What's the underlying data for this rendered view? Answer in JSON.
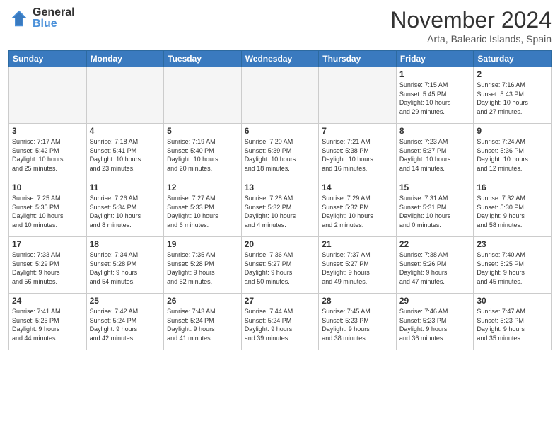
{
  "logo": {
    "general": "General",
    "blue": "Blue"
  },
  "title": "November 2024",
  "location": "Arta, Balearic Islands, Spain",
  "days_of_week": [
    "Sunday",
    "Monday",
    "Tuesday",
    "Wednesday",
    "Thursday",
    "Friday",
    "Saturday"
  ],
  "weeks": [
    [
      {
        "day": "",
        "info": "",
        "empty": true
      },
      {
        "day": "",
        "info": "",
        "empty": true
      },
      {
        "day": "",
        "info": "",
        "empty": true
      },
      {
        "day": "",
        "info": "",
        "empty": true
      },
      {
        "day": "",
        "info": "",
        "empty": true
      },
      {
        "day": "1",
        "info": "Sunrise: 7:15 AM\nSunset: 5:45 PM\nDaylight: 10 hours\nand 29 minutes."
      },
      {
        "day": "2",
        "info": "Sunrise: 7:16 AM\nSunset: 5:43 PM\nDaylight: 10 hours\nand 27 minutes."
      }
    ],
    [
      {
        "day": "3",
        "info": "Sunrise: 7:17 AM\nSunset: 5:42 PM\nDaylight: 10 hours\nand 25 minutes."
      },
      {
        "day": "4",
        "info": "Sunrise: 7:18 AM\nSunset: 5:41 PM\nDaylight: 10 hours\nand 23 minutes."
      },
      {
        "day": "5",
        "info": "Sunrise: 7:19 AM\nSunset: 5:40 PM\nDaylight: 10 hours\nand 20 minutes."
      },
      {
        "day": "6",
        "info": "Sunrise: 7:20 AM\nSunset: 5:39 PM\nDaylight: 10 hours\nand 18 minutes."
      },
      {
        "day": "7",
        "info": "Sunrise: 7:21 AM\nSunset: 5:38 PM\nDaylight: 10 hours\nand 16 minutes."
      },
      {
        "day": "8",
        "info": "Sunrise: 7:23 AM\nSunset: 5:37 PM\nDaylight: 10 hours\nand 14 minutes."
      },
      {
        "day": "9",
        "info": "Sunrise: 7:24 AM\nSunset: 5:36 PM\nDaylight: 10 hours\nand 12 minutes."
      }
    ],
    [
      {
        "day": "10",
        "info": "Sunrise: 7:25 AM\nSunset: 5:35 PM\nDaylight: 10 hours\nand 10 minutes."
      },
      {
        "day": "11",
        "info": "Sunrise: 7:26 AM\nSunset: 5:34 PM\nDaylight: 10 hours\nand 8 minutes."
      },
      {
        "day": "12",
        "info": "Sunrise: 7:27 AM\nSunset: 5:33 PM\nDaylight: 10 hours\nand 6 minutes."
      },
      {
        "day": "13",
        "info": "Sunrise: 7:28 AM\nSunset: 5:32 PM\nDaylight: 10 hours\nand 4 minutes."
      },
      {
        "day": "14",
        "info": "Sunrise: 7:29 AM\nSunset: 5:32 PM\nDaylight: 10 hours\nand 2 minutes."
      },
      {
        "day": "15",
        "info": "Sunrise: 7:31 AM\nSunset: 5:31 PM\nDaylight: 10 hours\nand 0 minutes."
      },
      {
        "day": "16",
        "info": "Sunrise: 7:32 AM\nSunset: 5:30 PM\nDaylight: 9 hours\nand 58 minutes."
      }
    ],
    [
      {
        "day": "17",
        "info": "Sunrise: 7:33 AM\nSunset: 5:29 PM\nDaylight: 9 hours\nand 56 minutes."
      },
      {
        "day": "18",
        "info": "Sunrise: 7:34 AM\nSunset: 5:28 PM\nDaylight: 9 hours\nand 54 minutes."
      },
      {
        "day": "19",
        "info": "Sunrise: 7:35 AM\nSunset: 5:28 PM\nDaylight: 9 hours\nand 52 minutes."
      },
      {
        "day": "20",
        "info": "Sunrise: 7:36 AM\nSunset: 5:27 PM\nDaylight: 9 hours\nand 50 minutes."
      },
      {
        "day": "21",
        "info": "Sunrise: 7:37 AM\nSunset: 5:27 PM\nDaylight: 9 hours\nand 49 minutes."
      },
      {
        "day": "22",
        "info": "Sunrise: 7:38 AM\nSunset: 5:26 PM\nDaylight: 9 hours\nand 47 minutes."
      },
      {
        "day": "23",
        "info": "Sunrise: 7:40 AM\nSunset: 5:25 PM\nDaylight: 9 hours\nand 45 minutes."
      }
    ],
    [
      {
        "day": "24",
        "info": "Sunrise: 7:41 AM\nSunset: 5:25 PM\nDaylight: 9 hours\nand 44 minutes."
      },
      {
        "day": "25",
        "info": "Sunrise: 7:42 AM\nSunset: 5:24 PM\nDaylight: 9 hours\nand 42 minutes."
      },
      {
        "day": "26",
        "info": "Sunrise: 7:43 AM\nSunset: 5:24 PM\nDaylight: 9 hours\nand 41 minutes."
      },
      {
        "day": "27",
        "info": "Sunrise: 7:44 AM\nSunset: 5:24 PM\nDaylight: 9 hours\nand 39 minutes."
      },
      {
        "day": "28",
        "info": "Sunrise: 7:45 AM\nSunset: 5:23 PM\nDaylight: 9 hours\nand 38 minutes."
      },
      {
        "day": "29",
        "info": "Sunrise: 7:46 AM\nSunset: 5:23 PM\nDaylight: 9 hours\nand 36 minutes."
      },
      {
        "day": "30",
        "info": "Sunrise: 7:47 AM\nSunset: 5:23 PM\nDaylight: 9 hours\nand 35 minutes."
      }
    ]
  ]
}
